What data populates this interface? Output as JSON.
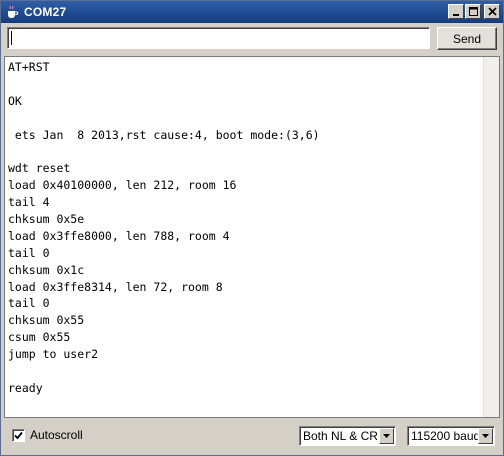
{
  "window": {
    "title": "COM27",
    "app_icon": "java-cup-icon"
  },
  "title_buttons": [
    {
      "name": "minimize",
      "icon": "minimize-icon"
    },
    {
      "name": "maximize",
      "icon": "maximize-icon"
    },
    {
      "name": "close",
      "icon": "close-icon"
    }
  ],
  "input": {
    "value": "",
    "send_label": "Send"
  },
  "output": {
    "lines": [
      "AT+RST",
      "",
      "OK",
      "",
      " ets Jan  8 2013,rst cause:4, boot mode:(3,6)",
      "",
      "wdt reset",
      "load 0x40100000, len 212, room 16",
      "tail 4",
      "chksum 0x5e",
      "load 0x3ffe8000, len 788, room 4",
      "tail 0",
      "chksum 0x1c",
      "load 0x3ffe8314, len 72, room 8",
      "tail 0",
      "chksum 0x55",
      "csum 0x55",
      "jump to user2",
      "",
      "ready"
    ]
  },
  "footer": {
    "autoscroll_label": "Autoscroll",
    "autoscroll_checked": true,
    "line_ending": "Both NL & CR",
    "baud_rate": "115200 baud"
  },
  "colors": {
    "titlebar": "#1e4a91",
    "chrome": "#d4d0c8",
    "output_bg": "#ffffff"
  }
}
